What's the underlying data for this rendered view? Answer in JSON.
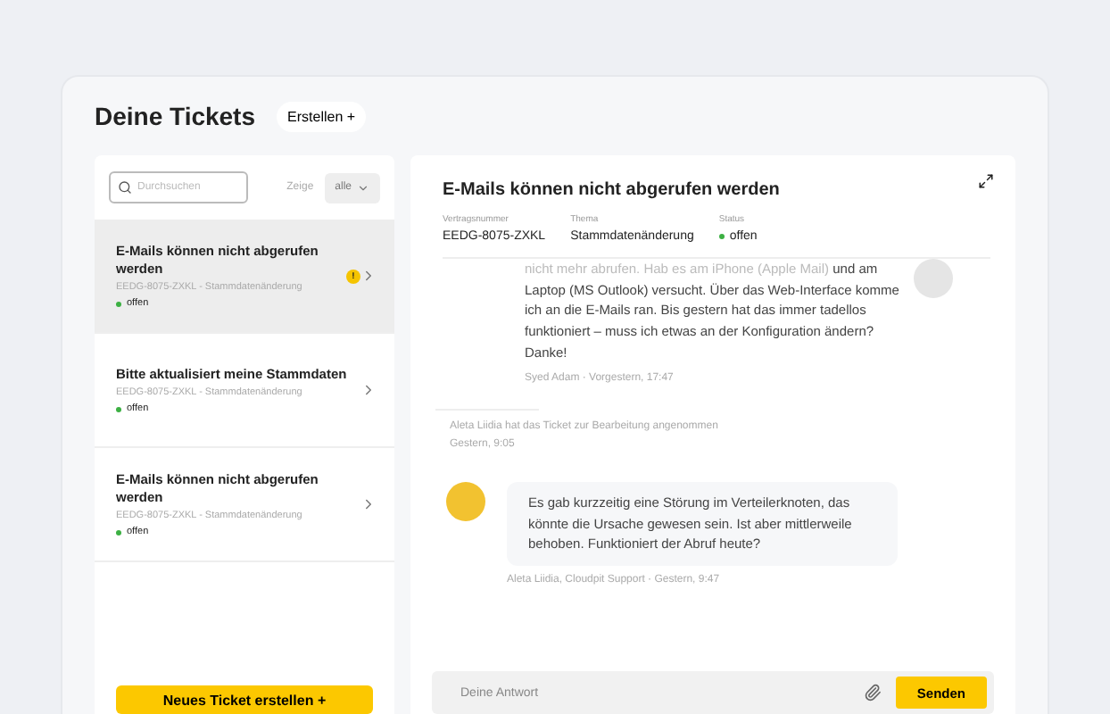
{
  "header": {
    "title": "Deine Tickets",
    "create_label": "Erstellen +"
  },
  "list_toolbar": {
    "search_placeholder": "Durchsuchen",
    "filter_label": "Zeige",
    "filter_value": "alle"
  },
  "tickets": [
    {
      "title": "E-Mails können nicht abgerufen werden",
      "meta": "EEDG-8075-ZXKL - Stammdatenänderung",
      "status": "offen",
      "color": "#3cb043",
      "badge": "!",
      "selected": true
    },
    {
      "title": "Bitte aktualisiert meine Stammdaten",
      "meta": "EEDG-8075-ZXKL - Stammdatenänderung",
      "status": "offen",
      "color": "#3cb043",
      "selected": false
    },
    {
      "title": "E-Mails können nicht abgerufen werden",
      "meta": "EEDG-8075-ZXKL - Stammdatenänderung",
      "status": "offen",
      "color": "#3cb043",
      "selected": false
    }
  ],
  "new_ticket_button": "Neues Ticket erstellen +",
  "detail": {
    "title": "E-Mails können nicht abgerufen werden",
    "fields": [
      {
        "label": "Vertragsnummer",
        "value": "EEDG-8075-ZXKL"
      },
      {
        "label": "Thema",
        "value": "Stammdatenänderung"
      },
      {
        "label": "Status",
        "value": "offen",
        "color": "#3cb043"
      }
    ],
    "messages": [
      {
        "kind": "outgoing",
        "lines": [
          "nicht mehr abrufen. Hab es am iPhone (Apple Mail)",
          "und am Laptop (MS Outlook) versucht. Über das Web-Interface komme ich an die E-Mails ran. Bis gestern hat das immer tadellos funktioniert – muss ich etwas an der Konfiguration ändern? Danke!"
        ],
        "footer": "Syed Adam · Vorgestern, 17:47"
      },
      {
        "kind": "event",
        "lines": [
          "Aleta Liidia hat das Ticket zur Bearbeitung angenommen"
        ],
        "footer": "Gestern, 9:05"
      },
      {
        "kind": "incoming",
        "lines": [
          "Es gab kurzzeitig eine Störung im Verteilerknoten, das könnte die Ursache gewesen sein. Ist aber mittlerweile behoben. Funktioniert der Abruf heute?"
        ],
        "footer": "Aleta Liidia, Cloudpit Support · Gestern, 9:47"
      }
    ],
    "reply_placeholder": "Deine Antwort",
    "send_label": "Senden"
  }
}
